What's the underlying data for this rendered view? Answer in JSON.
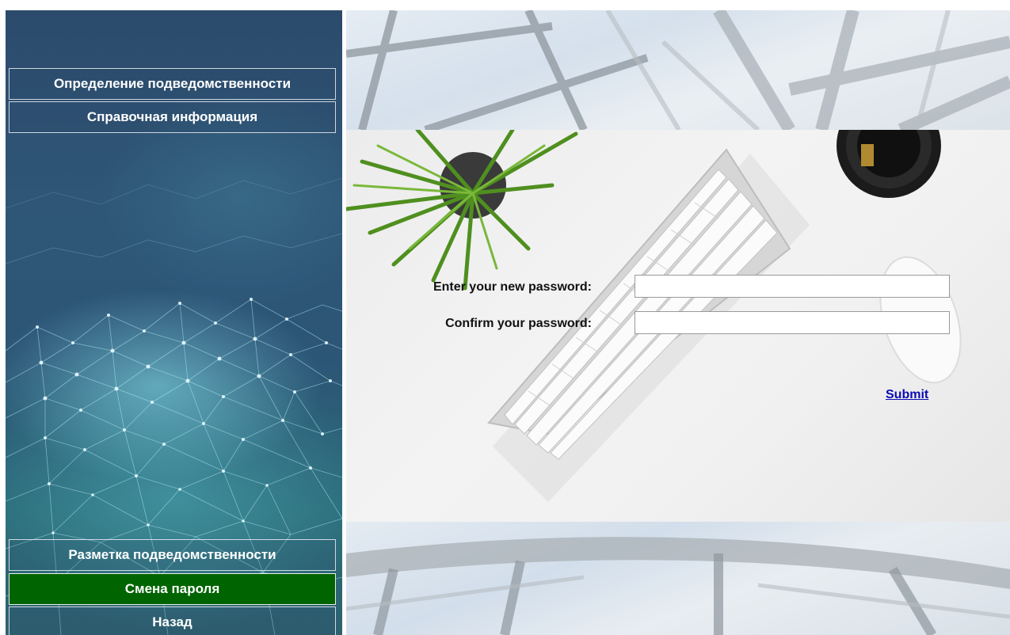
{
  "sidebar": {
    "top_items": [
      {
        "label": "Определение подведомственности"
      },
      {
        "label": "Справочная информация"
      }
    ],
    "bottom_items": [
      {
        "label": "Разметка подведомственности"
      },
      {
        "label": "Смена пароля",
        "active": true
      },
      {
        "label": "Назад"
      }
    ],
    "active_color": "#006400"
  },
  "form": {
    "new_password_label": "Enter your new password:",
    "new_password_value": "",
    "confirm_password_label": "Confirm your password:",
    "confirm_password_value": "",
    "submit_label": "Submit"
  },
  "colors": {
    "link": "#0a0ab4",
    "sidebar_bg": "#2c4b6c"
  }
}
